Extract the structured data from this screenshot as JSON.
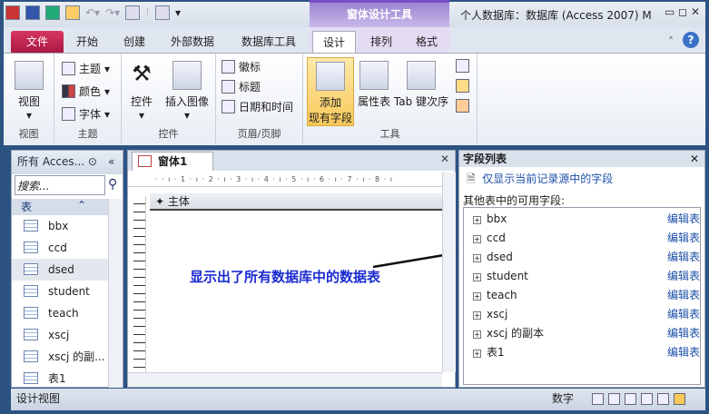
{
  "title": {
    "context_tools": "窗体设计工具",
    "app_title": "个人数据库：数据库 (Access 2007) M",
    "win_buttons": "▭ ◻ ✕"
  },
  "tabs": {
    "file": "文件",
    "items": [
      "开始",
      "创建",
      "外部数据",
      "数据库工具",
      "设计",
      "排列",
      "格式"
    ],
    "active": "设计"
  },
  "ribbon": {
    "view": {
      "button": "视图",
      "group": "视图"
    },
    "theme": {
      "items": [
        "主题",
        "颜色",
        "字体"
      ],
      "group": "主题"
    },
    "controls": {
      "controls": "控件",
      "insert_image": "插入图像",
      "group": "控件"
    },
    "header": {
      "items": [
        "徽标",
        "标题",
        "日期和时间"
      ],
      "group": "页眉/页脚"
    },
    "tools": {
      "add_fields_1": "添加",
      "add_fields_2": "现有字段",
      "property": "属性表",
      "tab_order": "Tab 键次序",
      "group": "工具"
    }
  },
  "nav": {
    "title": "所有 Acces...",
    "search_placeholder": "搜索...",
    "group": "表",
    "items": [
      "bbx",
      "ccd",
      "dsed",
      "student",
      "teach",
      "xscj",
      "xscj 的副...",
      "表1"
    ],
    "selected": "dsed"
  },
  "doc": {
    "tab": "窗体1",
    "ruler": "· · ı · 1 · ı · 2 · ı · 3 · ı · 4 · ı · 5 · ı · 6 · ı · 7 · ı · 8 · ı",
    "section": "主体",
    "annotation": "显示出了所有数据库中的数据表"
  },
  "fieldlist": {
    "title": "字段列表",
    "show_only": "仅显示当前记录源中的字段",
    "other_label": "其他表中的可用字段:",
    "edit": "编辑表",
    "tables": [
      "bbx",
      "ccd",
      "dsed",
      "student",
      "teach",
      "xscj",
      "xscj 的副本",
      "表1"
    ]
  },
  "status": {
    "left": "设计视图",
    "right": "数字"
  }
}
